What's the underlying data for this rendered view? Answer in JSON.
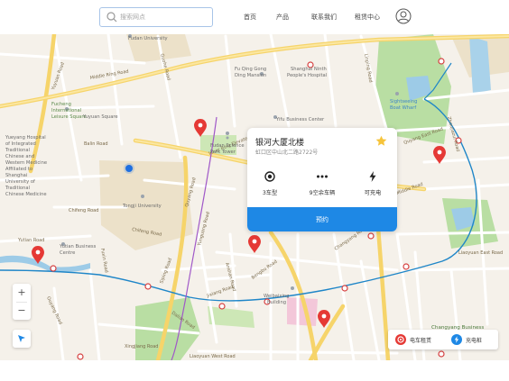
{
  "header": {
    "search_placeholder": "搜索网点",
    "nav": [
      {
        "label": "首页"
      },
      {
        "label": "产品"
      },
      {
        "label": "联系我们"
      },
      {
        "label": "租赁中心"
      }
    ]
  },
  "map": {
    "labels": {
      "fudan_university": "Fudan University",
      "fu_qing_ding_mansion_1": "Fu Qing Gong",
      "fu_qing_ding_mansion_2": "Ding Mansion",
      "shanghai_ninth_1": "Shanghai Ninth",
      "shanghai_ninth_2": "People's Hospital",
      "middle_ring_road": "Middle Ring Road",
      "fucheng_1": "Fucheng",
      "fucheng_2": "International",
      "fucheng_3": "Leisure Square",
      "yuyuan_square": "Yuyuan Square",
      "yueyang_1": "Yueyang Hospital",
      "yueyang_2": "of Integrated",
      "yueyang_3": "Traditional",
      "yueyang_4": "Chinese and",
      "yueyang_5": "Western Medicine",
      "yueyang_6": "Affiliated to",
      "yueyang_7": "Shanghai",
      "yueyang_8": "University of",
      "yueyang_9": "Traditional",
      "yueyang_10": "Chinese Medicine",
      "balin_road": "Balin Road",
      "inner_ring_elevated": "Inner Ring Elevated Road",
      "fudan_science_1": "Fudan Science",
      "fudan_science_2": "Park Tower",
      "yifu_business": "Yifu Business Center",
      "sightseeing_1": "Sightseeing",
      "sightseeing_2": "Boat Wharf",
      "tongji_university": "Tongji University",
      "chifeng_road": "Chifeng Road",
      "chifeng_road_2": "Chifeng Road",
      "yutian_road": "Yutian Road",
      "yutian_business_1": "Yutian Business",
      "yutian_business_2": "Centre",
      "quyang_east_road": "Quyang East Road",
      "middle_road": "Middle Road",
      "changyang_road": "Changyang Road",
      "ouyang_road": "Ouyang Road",
      "siping_road": "Siping Road",
      "dalian_road": "Dalian Road",
      "xingjiang_road": "Xingjiang Road",
      "liaoyuan_west_road": "Liaoyuan West Road",
      "liaoyuan_east_road": "Liaoyuan East Road",
      "weibaixing_1": "Weibaixing",
      "weibaixing_2": "Building",
      "changyang_business": "Changyang Business",
      "zhoujiazui_road": "Zhoujiazui Road",
      "linping_road": "Linping Road",
      "quyang_road": "Quyang Road",
      "anshan_road": "Anshan Road",
      "yuyuan_road": "Yuyuan Road",
      "yunguang_road": "Yunguang Road",
      "bengbu_road": "Bengbu Road",
      "jixiang_road": "Jixiang Road",
      "guohe_road": "Guohe Road",
      "fuxin_road": "Fuxin Road"
    }
  },
  "card": {
    "title": "银河大厦北楼",
    "address": "虹口区中山北二路2722号",
    "features": [
      {
        "icon": "car-type-icon",
        "label": "3车型"
      },
      {
        "icon": "more-dots-icon",
        "label": "9空余车辆"
      },
      {
        "icon": "lightning-icon",
        "label": "可充电"
      }
    ],
    "reserve_label": "预约"
  },
  "controls": {
    "zoom_in": "+",
    "zoom_out": "−"
  },
  "legend": {
    "items": [
      {
        "label": "电车租赁"
      },
      {
        "label": "充电桩"
      }
    ]
  },
  "colors": {
    "accent": "#1e88e5",
    "pin": "#e53935",
    "star": "#f6c43b",
    "road_major": "#f8d35c",
    "park": "#b5dd9d",
    "water": "#9dcbe7",
    "metro_blue": "#1f86c8",
    "metro_purple": "#a058c8"
  }
}
